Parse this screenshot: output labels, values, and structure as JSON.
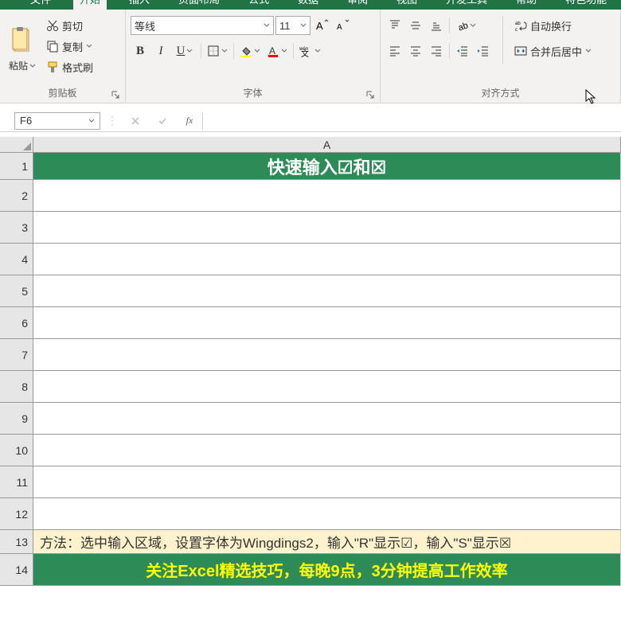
{
  "tabs": {
    "t0": "文件",
    "t1": "开始",
    "t2": "插入",
    "t3": "页面布局",
    "t4": "公式",
    "t5": "数据",
    "t6": "审阅",
    "t7": "视图",
    "t8": "开发工具",
    "t9": "帮助",
    "t10": "特色功能"
  },
  "clipboard": {
    "paste": "粘贴",
    "cut": "剪切",
    "copy": "复制",
    "format_painter": "格式刷",
    "group_label": "剪贴板"
  },
  "font": {
    "name": "等线",
    "size": "11",
    "group_label": "字体"
  },
  "alignment": {
    "wrap": "自动换行",
    "merge": "合并后居中",
    "group_label": "对齐方式"
  },
  "name_box": "F6",
  "formula_bar": "",
  "grid": {
    "col_a": "A",
    "rows": [
      "1",
      "2",
      "3",
      "4",
      "5",
      "6",
      "7",
      "8",
      "9",
      "10",
      "11",
      "12",
      "13",
      "14"
    ],
    "a1": "快速输入☑和☒",
    "a13": "方法：选中输入区域，设置字体为Wingdings2，输入\"R\"显示☑，输入\"S\"显示☒",
    "a14": "关注Excel精选技巧，每晚9点，3分钟提高工作效率"
  }
}
